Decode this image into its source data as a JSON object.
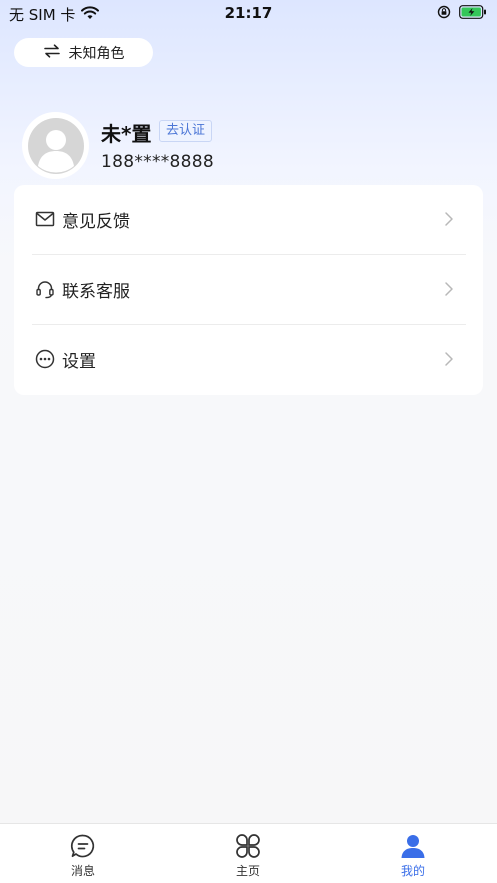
{
  "status_bar": {
    "carrier": "无 SIM 卡",
    "time": "21:17"
  },
  "role_switch": {
    "label": "未知角色"
  },
  "profile": {
    "name": "未*置",
    "verify_label": "去认证",
    "phone": "188****8888"
  },
  "menu": {
    "items": [
      {
        "label": "意见反馈",
        "icon": "mail-icon"
      },
      {
        "label": "联系客服",
        "icon": "headset-icon"
      },
      {
        "label": "设置",
        "icon": "more-dots-icon"
      }
    ]
  },
  "tab_bar": {
    "tabs": [
      {
        "label": "消息",
        "icon": "message-icon",
        "active": false
      },
      {
        "label": "主页",
        "icon": "grid-home-icon",
        "active": false
      },
      {
        "label": "我的",
        "icon": "person-icon",
        "active": true
      }
    ]
  },
  "colors": {
    "accent": "#3a6ee8",
    "tag_text": "#4a75d6",
    "tag_bg": "#eef3ff",
    "battery": "#34c759"
  }
}
